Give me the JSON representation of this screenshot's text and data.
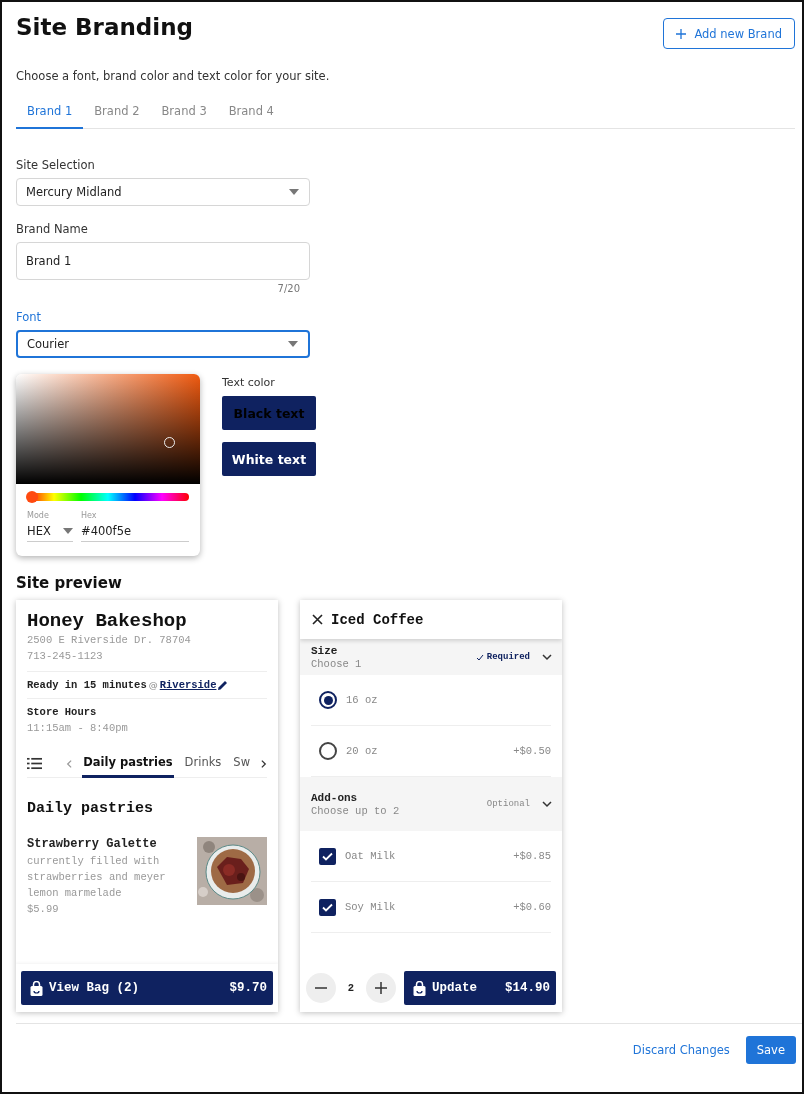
{
  "page": {
    "title": "Site Branding",
    "subtitle": "Choose a font, brand color and text color for your site.",
    "add_button": "Add new Brand"
  },
  "tabs": [
    {
      "label": "Brand 1",
      "selected": true
    },
    {
      "label": "Brand 2",
      "selected": false
    },
    {
      "label": "Brand 3",
      "selected": false
    },
    {
      "label": "Brand 4",
      "selected": false
    }
  ],
  "form": {
    "site_label": "Site Selection",
    "site_value": "Mercury Midland",
    "name_label": "Brand Name",
    "name_value": "Brand 1",
    "name_counter": "7/20",
    "font_label": "Font",
    "font_value": "Courier",
    "font_focused": true
  },
  "color_picker": {
    "hue": {
      "level": 0.03
    },
    "mode_label": "Mode",
    "mode": "HEX",
    "hex_label": "Hex",
    "hex": "#400f5e"
  },
  "text_color": {
    "label": "Text color",
    "options": [
      {
        "label": "Black text",
        "kind": "dark"
      },
      {
        "label": "White text",
        "kind": "light"
      }
    ]
  },
  "preview": {
    "title": "Site preview",
    "store": {
      "name": "Honey Bakeshop",
      "address": "2500 E Riverside Dr. 78704",
      "phone": "713-245-1123",
      "ready": "Ready in 15 minutes",
      "at": "@",
      "location": "Riverside",
      "hours_label": "Store Hours",
      "hours": "11:15am - 8:40pm",
      "categories": [
        {
          "label": "Daily pastries",
          "selected": true
        },
        {
          "label": "Drinks",
          "selected": false
        },
        {
          "label": "Sw",
          "selected": false
        }
      ],
      "section": "Daily pastries",
      "item": {
        "name": "Strawberry Galette",
        "description": "currently filled with strawberries and meyer lemon marmelade",
        "price": "$5.99"
      },
      "bag": {
        "label": "View Bag (2)",
        "total": "$9.70"
      }
    },
    "product": {
      "title": "Iced Coffee",
      "groups": [
        {
          "title": "Size",
          "subtitle": "Choose 1",
          "badge": "Required",
          "required": true,
          "options": [
            {
              "kind": "radio",
              "label": "16 oz",
              "selected": true
            },
            {
              "kind": "radio",
              "label": "20 oz",
              "price": "+$0.50",
              "selected": false
            }
          ]
        },
        {
          "title": "Add-ons",
          "subtitle": "Choose up to 2",
          "badge": "Optional",
          "required": false,
          "options": [
            {
              "kind": "checkbox",
              "label": "Oat Milk",
              "price": "+$0.85",
              "checked": true
            },
            {
              "kind": "checkbox",
              "label": "Soy Milk",
              "price": "+$0.60",
              "checked": true
            }
          ]
        }
      ],
      "quantity": "2",
      "update": {
        "label": "Update",
        "total": "$14.90"
      }
    }
  },
  "footer": {
    "discard": "Discard Changes",
    "save": "Save"
  }
}
